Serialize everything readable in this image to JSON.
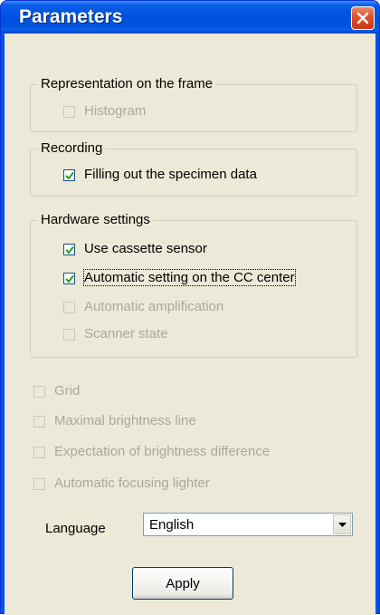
{
  "window": {
    "title": "Parameters"
  },
  "groups": {
    "representation": {
      "title": "Representation on the frame",
      "items": [
        {
          "label": "Histogram",
          "checked": false,
          "enabled": false
        }
      ]
    },
    "recording": {
      "title": "Recording",
      "items": [
        {
          "label": "Filling out the specimen data",
          "checked": true,
          "enabled": true
        }
      ]
    },
    "hardware": {
      "title": "Hardware settings",
      "items": [
        {
          "label": "Use cassette sensor",
          "checked": true,
          "enabled": true
        },
        {
          "label": "Automatic setting on the CC center",
          "checked": true,
          "enabled": true,
          "focused": true
        },
        {
          "label": "Automatic amplification",
          "checked": false,
          "enabled": false
        },
        {
          "label": "Scanner state",
          "checked": false,
          "enabled": false
        }
      ]
    }
  },
  "options": [
    {
      "label": "Grid",
      "checked": false,
      "enabled": false
    },
    {
      "label": "Maximal brightness line",
      "checked": false,
      "enabled": false
    },
    {
      "label": "Expectation of brightness difference",
      "checked": false,
      "enabled": false
    },
    {
      "label": "Automatic focusing lighter",
      "checked": false,
      "enabled": false
    }
  ],
  "language": {
    "label": "Language",
    "value": "English"
  },
  "apply_label": "Apply",
  "colors": {
    "titlebar": "#0055e5",
    "client": "#ece9d8",
    "disabled_text": "#aca899",
    "close_button": "#e0512a"
  }
}
